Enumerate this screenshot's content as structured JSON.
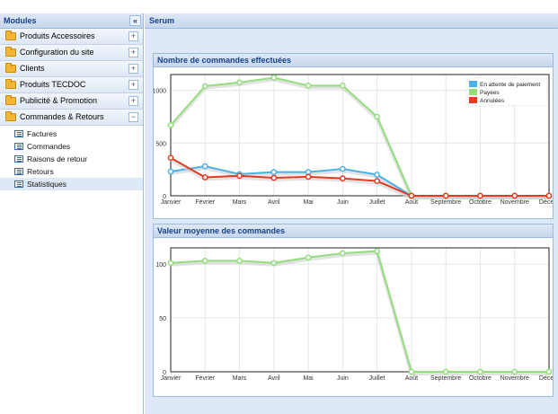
{
  "sidebar": {
    "title": "Modules",
    "collapse_glyph": "«",
    "items": [
      {
        "label": "Produits Accessoires",
        "icon": "folder-icon",
        "toggle": "+"
      },
      {
        "label": "Configuration du site",
        "icon": "folder-icon",
        "toggle": "+"
      },
      {
        "label": "Clients",
        "icon": "folder-icon",
        "toggle": "+"
      },
      {
        "label": "Produits TECDOC",
        "icon": "folder-icon",
        "toggle": "+"
      },
      {
        "label": "Publicité & Promotion",
        "icon": "folder-icon",
        "toggle": "+"
      },
      {
        "label": "Commandes & Retours",
        "icon": "folder-icon",
        "toggle": "−"
      }
    ],
    "subitems": [
      {
        "label": "Factures",
        "icon": "document-icon"
      },
      {
        "label": "Commandes",
        "icon": "document-icon"
      },
      {
        "label": "Raisons de retour",
        "icon": "document-icon"
      },
      {
        "label": "Retours",
        "icon": "document-icon"
      },
      {
        "label": "Statistiques",
        "icon": "document-icon",
        "selected": true
      }
    ]
  },
  "main": {
    "title": "Serum"
  },
  "colors": {
    "header_text": "#15428b",
    "panel_border": "#99bbe8",
    "body_bg": "#dfe8f6",
    "series_attente": "#4ab0e8",
    "series_payees": "#92de7d",
    "series_annulees": "#e53a22"
  },
  "chart_data": [
    {
      "type": "line",
      "title": "Nombre de commandes effectuées",
      "categories": [
        "Janvier",
        "Février",
        "Mars",
        "Avril",
        "Mai",
        "Juin",
        "Juillet",
        "Août",
        "Septembre",
        "Octobre",
        "Novembre",
        "Décem"
      ],
      "ylim": [
        0,
        1150
      ],
      "yticks": [
        0,
        500,
        1000
      ],
      "grid": true,
      "legend_position": "top-right",
      "series": [
        {
          "name": "En attente de paiement",
          "color": "#4ab0e8",
          "values": [
            230,
            280,
            205,
            225,
            225,
            255,
            200,
            0,
            0,
            0,
            0,
            0
          ]
        },
        {
          "name": "Payées",
          "color": "#92de7d",
          "values": [
            670,
            1040,
            1075,
            1120,
            1045,
            1045,
            750,
            0,
            0,
            0,
            0,
            0
          ]
        },
        {
          "name": "Annulées",
          "color": "#e53a22",
          "values": [
            360,
            175,
            190,
            170,
            180,
            165,
            140,
            0,
            0,
            0,
            0,
            0
          ]
        }
      ]
    },
    {
      "type": "line",
      "title": "Valeur moyenne des commandes",
      "categories": [
        "Janvier",
        "Février",
        "Mars",
        "Avril",
        "Mai",
        "Juin",
        "Juillet",
        "Août",
        "Septembre",
        "Octobre",
        "Novembre",
        "Décem"
      ],
      "ylim": [
        0,
        115
      ],
      "yticks": [
        0,
        50,
        100
      ],
      "grid": true,
      "series": [
        {
          "color": "#92de7d",
          "values": [
            101,
            103,
            103,
            101,
            106,
            110,
            112,
            0,
            0,
            0,
            0,
            0
          ]
        }
      ]
    }
  ]
}
